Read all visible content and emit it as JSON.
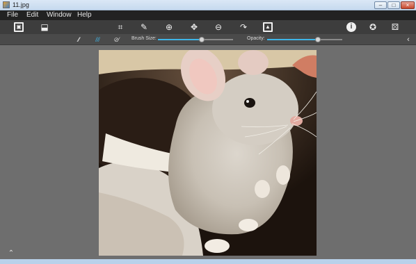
{
  "window": {
    "title": "11.jpg",
    "minimize": "–",
    "maximize": "□",
    "close": "×"
  },
  "menu": {
    "items": [
      "File",
      "Edit",
      "Window",
      "Help"
    ]
  },
  "toolbar": {
    "left_icons": [
      "preview-icon",
      "save-tray-icon"
    ],
    "center_icons": [
      "crop-icon",
      "brush-icon",
      "zoom-in-icon",
      "move-icon",
      "zoom-out-icon",
      "redo-icon",
      "image-icon"
    ],
    "right_icons": [
      "info-icon",
      "settings-icon",
      "effects-icon"
    ]
  },
  "brushbar": {
    "brush_size_label": "Brush Size:",
    "brush_size_value": 0.58,
    "opacity_label": "Opacity:",
    "opacity_value": 0.68,
    "brushes": [
      "brush-thin-icon",
      "brush-medium-icon",
      "brush-eraser-icon"
    ],
    "active_brush": 1,
    "accent_color": "#3fb6e8"
  },
  "canvas": {
    "background": "#6e6e6e",
    "image_subject": "chinchilla photo"
  }
}
